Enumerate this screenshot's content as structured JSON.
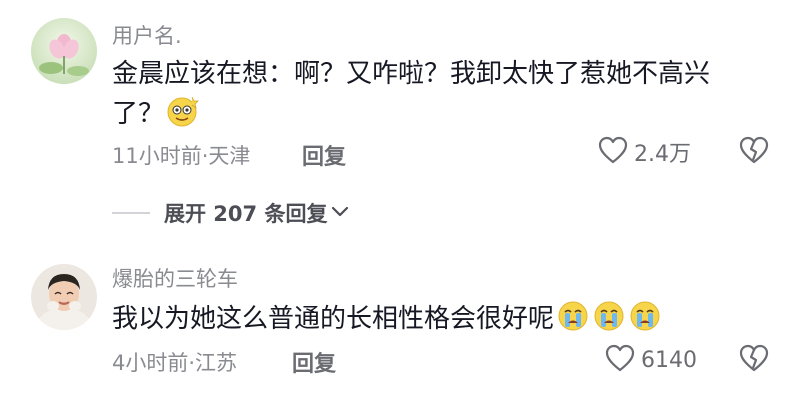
{
  "comments": [
    {
      "username": "用户名.",
      "text": "金晨应该在想：啊？又咋啦？我卸太快了惹她不高兴了？",
      "emojis": [
        "dizzy-smile-emoji"
      ],
      "time_location": "11小时前·天津",
      "reply_label": "回复",
      "likes": "2.4万"
    },
    {
      "username": "爆胎的三轮车",
      "text": "我以为她这么普通的长相性格会很好呢",
      "emojis": [
        "crying-emoji",
        "crying-emoji",
        "crying-emoji"
      ],
      "time_location": "4小时前·江苏",
      "reply_label": "回复",
      "likes": "6140"
    }
  ],
  "expand_replies": "展开 207 条回复",
  "icons": {
    "like": "heart-icon",
    "dislike": "broken-heart-icon",
    "expand": "chevron-down-icon"
  },
  "colors": {
    "text_primary": "#161823",
    "text_secondary": "#8a8b91",
    "icon": "#6b6c72"
  }
}
